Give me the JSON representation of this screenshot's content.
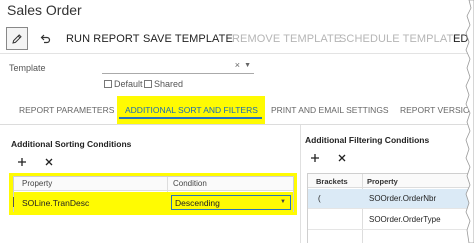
{
  "window": {
    "title": "Sales Order"
  },
  "toolbar": {
    "run_report": "RUN REPORT",
    "save_template": "SAVE TEMPLATE",
    "remove_template": "REMOVE TEMPLATE",
    "schedule_template": "SCHEDULE TEMPLATE",
    "overflow": "ED"
  },
  "template": {
    "label": "Template",
    "value": "",
    "clear_glyph": "×",
    "default_label": "Default",
    "shared_label": "Shared"
  },
  "tabs": [
    {
      "label": "REPORT PARAMETERS",
      "active": false
    },
    {
      "label": "ADDITIONAL SORT AND FILTERS",
      "active": true
    },
    {
      "label": "PRINT AND EMAIL SETTINGS",
      "active": false
    },
    {
      "label": "REPORT VERSION",
      "active": false
    }
  ],
  "sorting": {
    "title": "Additional Sorting Conditions",
    "columns": [
      "Property",
      "Condition"
    ],
    "rows": [
      {
        "property": "SOLine.TranDesc",
        "condition": "Descending"
      }
    ]
  },
  "filtering": {
    "title": "Additional Filtering Conditions",
    "columns": [
      "Brackets",
      "Property"
    ],
    "rows": [
      {
        "brackets": "(",
        "property": "SOOrder.OrderNbr"
      },
      {
        "brackets": "",
        "property": "SOOrder.OrderType"
      }
    ]
  },
  "colors": {
    "highlight": "#fffb02",
    "accent": "#2b73b9",
    "selected_row": "#dbeaf6"
  }
}
